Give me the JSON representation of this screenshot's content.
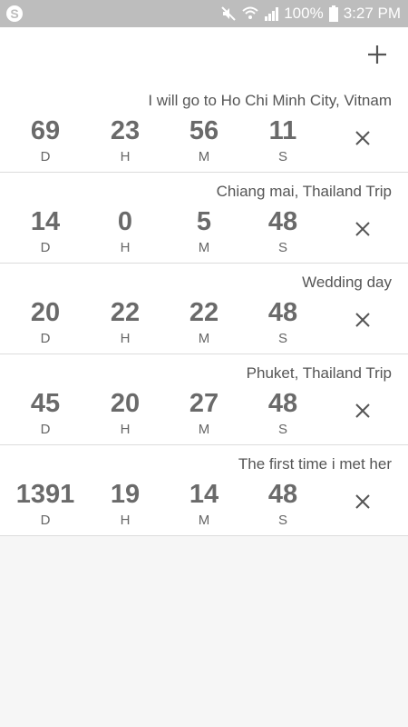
{
  "status_bar": {
    "battery": "100%",
    "time": "3:27 PM",
    "icons": [
      "skype-icon",
      "mute-icon",
      "wifi-icon",
      "signal-icon",
      "battery-icon"
    ]
  },
  "app_bar": {
    "add_icon": "plus-icon"
  },
  "labels": {
    "days": "D",
    "hours": "H",
    "minutes": "M",
    "seconds": "S"
  },
  "countdowns": [
    {
      "title": "I will go to Ho Chi Minh City, Vitnam",
      "days": "69",
      "hours": "23",
      "minutes": "56",
      "seconds": "11"
    },
    {
      "title": "Chiang mai, Thailand Trip",
      "days": "14",
      "hours": "0",
      "minutes": "5",
      "seconds": "48"
    },
    {
      "title": "Wedding day",
      "days": "20",
      "hours": "22",
      "minutes": "22",
      "seconds": "48"
    },
    {
      "title": "Phuket, Thailand Trip",
      "days": "45",
      "hours": "20",
      "minutes": "27",
      "seconds": "48"
    },
    {
      "title": "The first time i met her",
      "days": "1391",
      "hours": "19",
      "minutes": "14",
      "seconds": "48"
    }
  ],
  "colors": {
    "status_bar": "#bdbdbd",
    "background": "#f6f6f6",
    "number_text": "#6a6a6a",
    "divider": "#dcdcdc"
  }
}
